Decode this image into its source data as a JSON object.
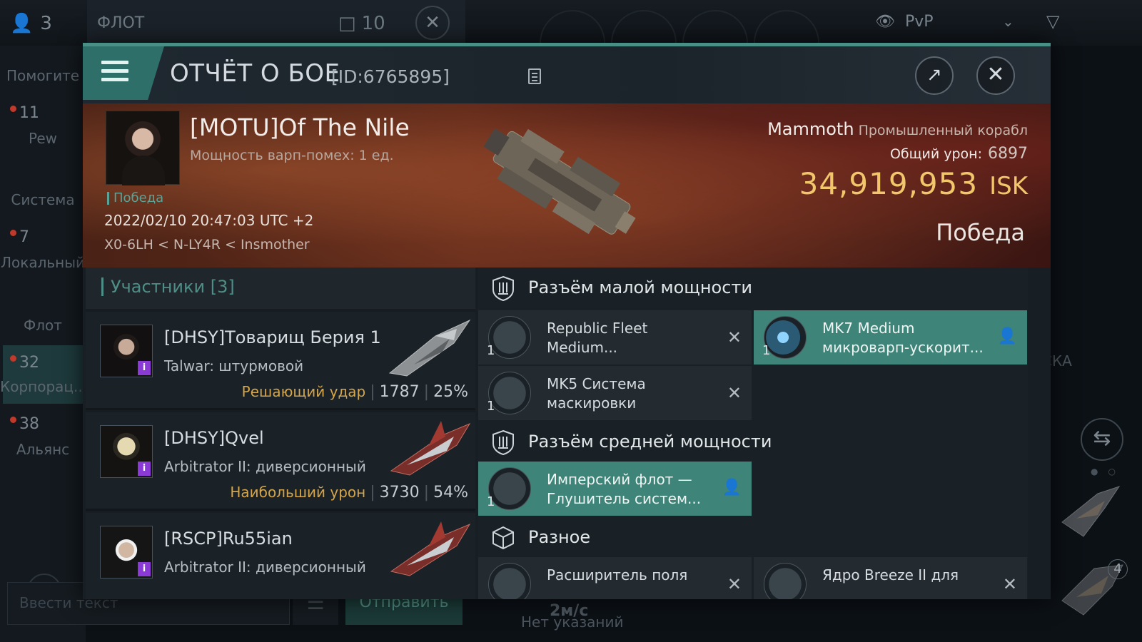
{
  "background": {
    "people_count": "3",
    "fleet_tab": {
      "label": "ФЛОТ",
      "count": "10"
    },
    "pvp_filter": "PvP",
    "sidebar": {
      "help": "Помогите",
      "pew_count": "11",
      "pew": "Pew",
      "system": "Система",
      "local_count": "7",
      "local": "Локальный",
      "fleet": "Флот",
      "corp_count": "32",
      "corp": "Корпорац...",
      "alliance_count": "38",
      "alliance": "Альянс"
    },
    "chat": {
      "placeholder": "Ввести текст",
      "send": "Отправить"
    },
    "speed": "2м/с",
    "no_orders": "Нет указаний",
    "right_label": "СКА",
    "right_badge": "4"
  },
  "report": {
    "title": "ОТЧЁТ О БОЕ",
    "id": "[ID:6765895]",
    "victim": {
      "name": "[MOTU]Of The Nile",
      "warp": "Мощность варп-помех: 1 ед.",
      "tag": "Победа",
      "datetime": "2022/02/10 20:47:03 UTC +2",
      "route": "X0-6LH < N-LY4R < Insmother",
      "ship_name": "Mammoth",
      "ship_class": "Промышленный корабл",
      "damage_label": "Общий урон:",
      "damage_value": "6897",
      "isk_value": "34,919,953",
      "isk_unit": "ISK",
      "result": "Победа"
    },
    "participants": {
      "header": "Участники [3]",
      "rows": [
        {
          "name": "[DHSY]Товарищ Берия 1",
          "ship": "Talwar: штурмовой",
          "tag": "Решающий удар",
          "damage": "1787",
          "percent": "25%"
        },
        {
          "name": "[DHSY]Qvel",
          "ship": "Arbitrator II: диверсионный",
          "tag": "Наибольший урон",
          "damage": "3730",
          "percent": "54%"
        },
        {
          "name": "[RSCP]Ru55ian",
          "ship": "Arbitrator II: диверсионный",
          "tag": "",
          "damage": "",
          "percent": ""
        }
      ]
    },
    "fitting": {
      "low_slot": "Разъём малой мощности",
      "mid_slot": "Разъём средней мощности",
      "misc_slot": "Разное",
      "modules": [
        {
          "name": "Republic Fleet Medium...",
          "qty": "1",
          "state": "destroyed"
        },
        {
          "name": "MK7 Medium микроварп-ускорит...",
          "qty": "1",
          "state": "dropped"
        },
        {
          "name": "MK5 Система маскировки",
          "qty": "1",
          "state": "destroyed"
        },
        {
          "name": "Имперский флот — Глушитель систем...",
          "qty": "1",
          "state": "dropped"
        },
        {
          "name": "Расширитель поля",
          "qty": "",
          "state": "destroyed"
        },
        {
          "name": "Ядро Breeze II для",
          "qty": "",
          "state": "destroyed"
        }
      ]
    }
  },
  "colors": {
    "accent": "#4a8f86",
    "highlight": "#3f8479",
    "gold": "#f2c76b",
    "victim_banner": "#5e2a1a"
  }
}
